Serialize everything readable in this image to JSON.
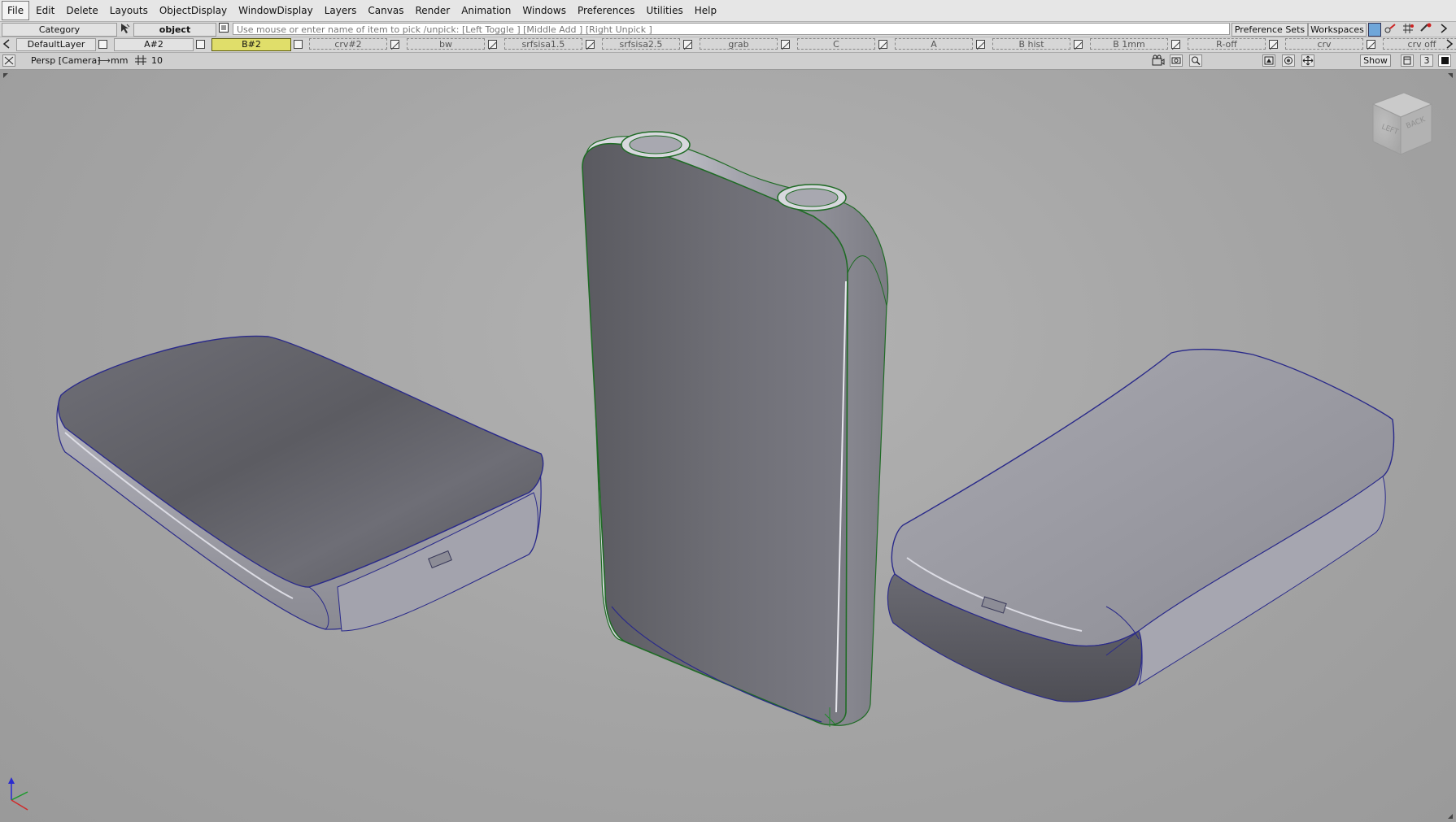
{
  "menu": [
    "File",
    "Edit",
    "Delete",
    "Layouts",
    "ObjectDisplay",
    "WindowDisplay",
    "Layers",
    "Canvas",
    "Render",
    "Animation",
    "Windows",
    "Preferences",
    "Utilities",
    "Help"
  ],
  "pickbar": {
    "category": "Category",
    "object": "object",
    "prompt": "Use mouse or enter name of item to pick /unpick: [Left Toggle ] [Middle Add ] [Right Unpick ]",
    "preference_sets": "Preference Sets",
    "workspaces": "Workspaces"
  },
  "layers": {
    "default": "DefaultLayer",
    "a": "A#2",
    "b": "B#2",
    "others": [
      "crv#2",
      "bw",
      "srfsisa1.5",
      "srfsisa2.5",
      "grab",
      "C",
      "A",
      "B hist",
      "B 1mm",
      "R-off",
      "crv",
      "crv off"
    ]
  },
  "viewport": {
    "title": "Persp [Camera]",
    "units": "mm",
    "grid": "10",
    "show": "Show",
    "count": "3",
    "viewcube_left": "LEFT",
    "viewcube_back": "BACK"
  },
  "colors": {
    "active_layer": "#e0de6a",
    "edge_blue": "#2a2a8a",
    "edge_green": "#1f6b25"
  }
}
